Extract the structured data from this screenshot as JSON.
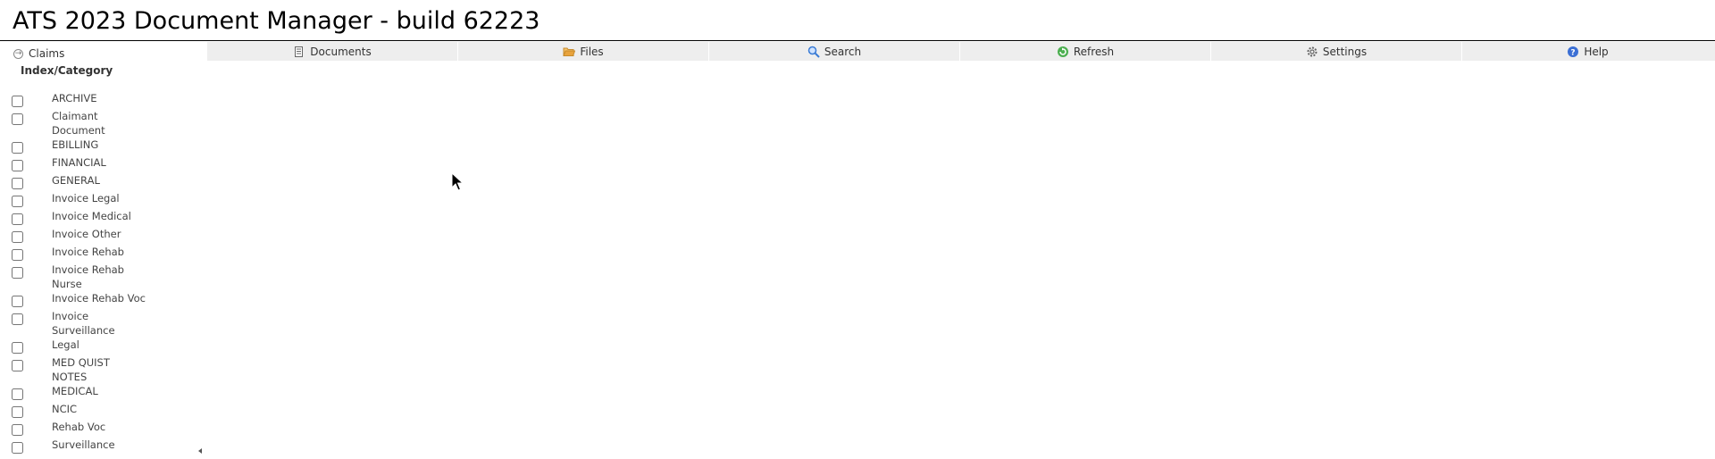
{
  "app": {
    "title": "ATS 2023 Document Manager - build 62223"
  },
  "sidebar": {
    "claims_label": "Claims",
    "heading": "Index/Category",
    "categories": [
      {
        "lines": [
          "ARCHIVE"
        ],
        "checked": false
      },
      {
        "lines": [
          "Claimant",
          "Document"
        ],
        "checked": false
      },
      {
        "lines": [
          "EBILLING"
        ],
        "checked": false
      },
      {
        "lines": [
          "FINANCIAL"
        ],
        "checked": false
      },
      {
        "lines": [
          "GENERAL"
        ],
        "checked": false
      },
      {
        "lines": [
          "Invoice Legal"
        ],
        "checked": false
      },
      {
        "lines": [
          "Invoice Medical"
        ],
        "checked": false
      },
      {
        "lines": [
          "Invoice Other"
        ],
        "checked": false
      },
      {
        "lines": [
          "Invoice Rehab"
        ],
        "checked": false
      },
      {
        "lines": [
          "Invoice Rehab",
          "Nurse"
        ],
        "checked": false
      },
      {
        "lines": [
          "Invoice Rehab Voc"
        ],
        "checked": false
      },
      {
        "lines": [
          "Invoice",
          "Surveillance"
        ],
        "checked": false
      },
      {
        "lines": [
          "Legal"
        ],
        "checked": false
      },
      {
        "lines": [
          "MED QUIST",
          "NOTES"
        ],
        "checked": false
      },
      {
        "lines": [
          "MEDICAL"
        ],
        "checked": false
      },
      {
        "lines": [
          "NCIC"
        ],
        "checked": false
      },
      {
        "lines": [
          "Rehab Voc"
        ],
        "checked": false
      },
      {
        "lines": [
          "Surveillance"
        ],
        "checked": false
      }
    ]
  },
  "toolbar": {
    "documents": "Documents",
    "files": "Files",
    "search": "Search",
    "refresh": "Refresh",
    "settings": "Settings",
    "help": "Help"
  },
  "icons": {
    "claims": "circle-arrow-right-icon",
    "documents": "document-icon",
    "files": "open-folder-icon",
    "search": "magnifier-icon",
    "refresh": "refresh-icon",
    "settings": "gear-icon",
    "help": "help-icon"
  },
  "colors": {
    "toolbar_bg": "#eeeeee",
    "folder": "#e8a33d",
    "search": "#3a7bd5",
    "refresh": "#4caf50",
    "help": "#3b6fd4"
  }
}
